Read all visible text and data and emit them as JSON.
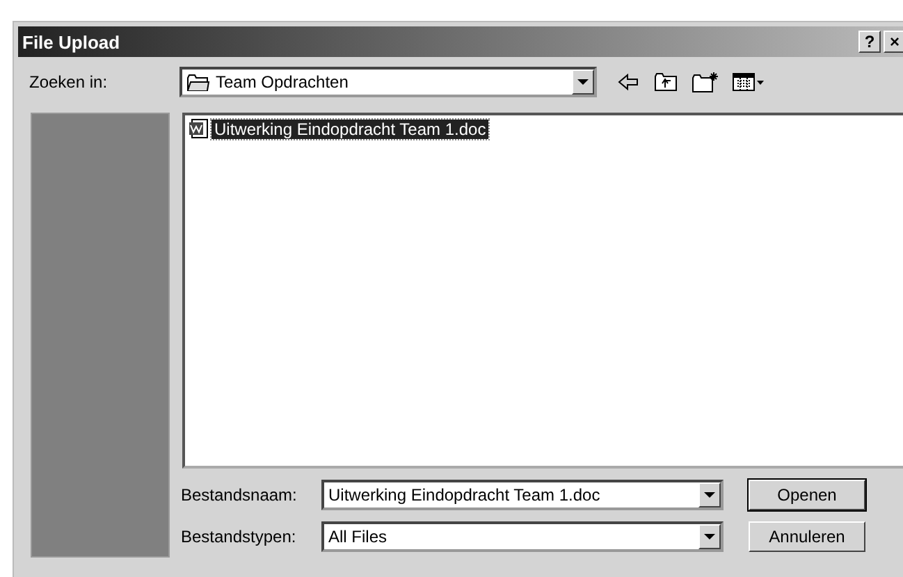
{
  "window": {
    "title": "File Upload",
    "help_button": "?",
    "close_button": "×"
  },
  "look_in": {
    "label": "Zoeken in:",
    "value": "Team Opdrachten"
  },
  "files": [
    {
      "name": "Uitwerking Eindopdracht Team 1.doc",
      "selected": true
    }
  ],
  "file_name": {
    "label": "Bestandsnaam:",
    "value": "Uitwerking Eindopdracht Team 1.doc"
  },
  "file_type": {
    "label": "Bestandstypen:",
    "value": "All Files"
  },
  "buttons": [
    {
      "label": "Openen",
      "default": true
    },
    {
      "label": "Annuleren",
      "default": false
    }
  ]
}
